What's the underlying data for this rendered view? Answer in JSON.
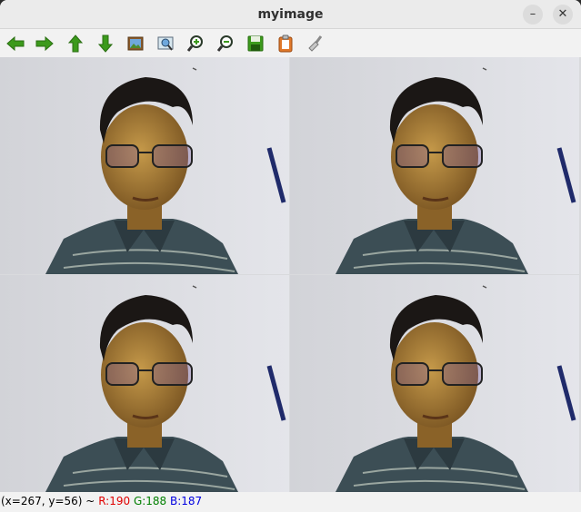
{
  "window": {
    "title": "myimage",
    "minimize_glyph": "–",
    "close_glyph": "✕"
  },
  "toolbar": {
    "buttons": [
      {
        "icon": "arrow-left-icon"
      },
      {
        "icon": "arrow-right-icon"
      },
      {
        "icon": "arrow-up-icon"
      },
      {
        "icon": "arrow-down-icon"
      },
      {
        "icon": "image-icon"
      },
      {
        "icon": "zoom-fit-icon"
      },
      {
        "icon": "zoom-in-icon"
      },
      {
        "icon": "zoom-out-icon"
      },
      {
        "icon": "save-icon"
      },
      {
        "icon": "clipboard-icon"
      },
      {
        "icon": "clear-brush-icon"
      }
    ]
  },
  "image": {
    "tiles": 4,
    "grid": "2x2",
    "content": "portrait-photo"
  },
  "status": {
    "coords": "(x=267, y=56) ~",
    "r": "R:190",
    "g": "G:188",
    "b": "B:187"
  },
  "colors": {
    "arrow_green": "#3c9a1c",
    "r_color": "#e00000",
    "g_color": "#007f00",
    "b_color": "#0000e0"
  }
}
